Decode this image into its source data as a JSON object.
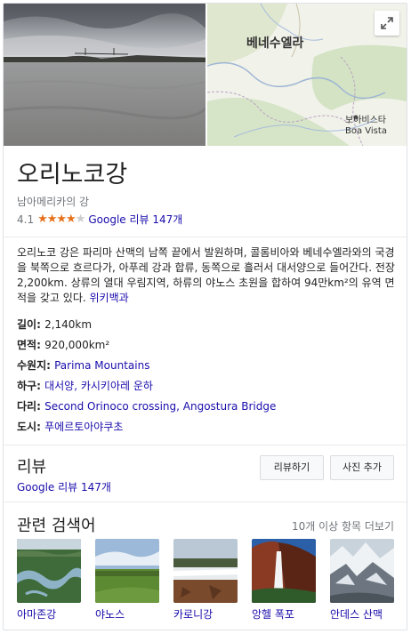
{
  "map": {
    "country_label": "베네수엘라",
    "city_label_ko": "보아비스타",
    "city_label_en": "Boa Vista"
  },
  "title": "오리노코강",
  "subtitle": "남아메리카의 강",
  "rating": {
    "value": "4.1",
    "stars_filled": 4,
    "stars_total": 5,
    "reviews_link": "Google 리뷰 147개"
  },
  "description": {
    "text": "오리노코 강은 파리마 산맥의 남쪽 끝에서 발원하며, 콜롬비아와 베네수엘라와의 국경을 북쪽으로 흐르다가, 아푸레 강과 합류, 동쪽으로 흘러서 대서양으로 들어간다. 전장 2,200km. 상류의 열대 우림지역, 하류의 야노스 초원을 합하여 94만km²의 유역 면적을 갖고 있다.",
    "source_link": "위키백과"
  },
  "facts": [
    {
      "label": "길이",
      "value": "2,140km",
      "is_link": false
    },
    {
      "label": "면적",
      "value": "920,000km²",
      "is_link": false
    },
    {
      "label": "수원지",
      "value": "Parima Mountains",
      "is_link": true
    },
    {
      "label": "하구",
      "value": "대서양, 카시키아레 운하",
      "is_link": true
    },
    {
      "label": "다리",
      "value": "Second Orinoco crossing, Angostura Bridge",
      "is_link": true
    },
    {
      "label": "도시",
      "value": "푸에르토아야쿠초",
      "is_link": true
    }
  ],
  "reviews": {
    "title": "리뷰",
    "link": "Google 리뷰 147개",
    "write_button": "리뷰하기",
    "photo_button": "사진 추가"
  },
  "related": {
    "title": "관련 검색어",
    "more": "10개 이상 항목 더보기",
    "items": [
      {
        "label": "아마존강",
        "icon": "river-thumbnail"
      },
      {
        "label": "야노스",
        "icon": "grassland-thumbnail"
      },
      {
        "label": "카로니강",
        "icon": "waterfall-river-thumbnail"
      },
      {
        "label": "앙헬 폭포",
        "icon": "angel-falls-thumbnail"
      },
      {
        "label": "안데스 산맥",
        "icon": "mountain-thumbnail"
      }
    ]
  },
  "colors": {
    "link": "#1a0dab",
    "star": "#e7711b",
    "muted": "#70757a"
  }
}
